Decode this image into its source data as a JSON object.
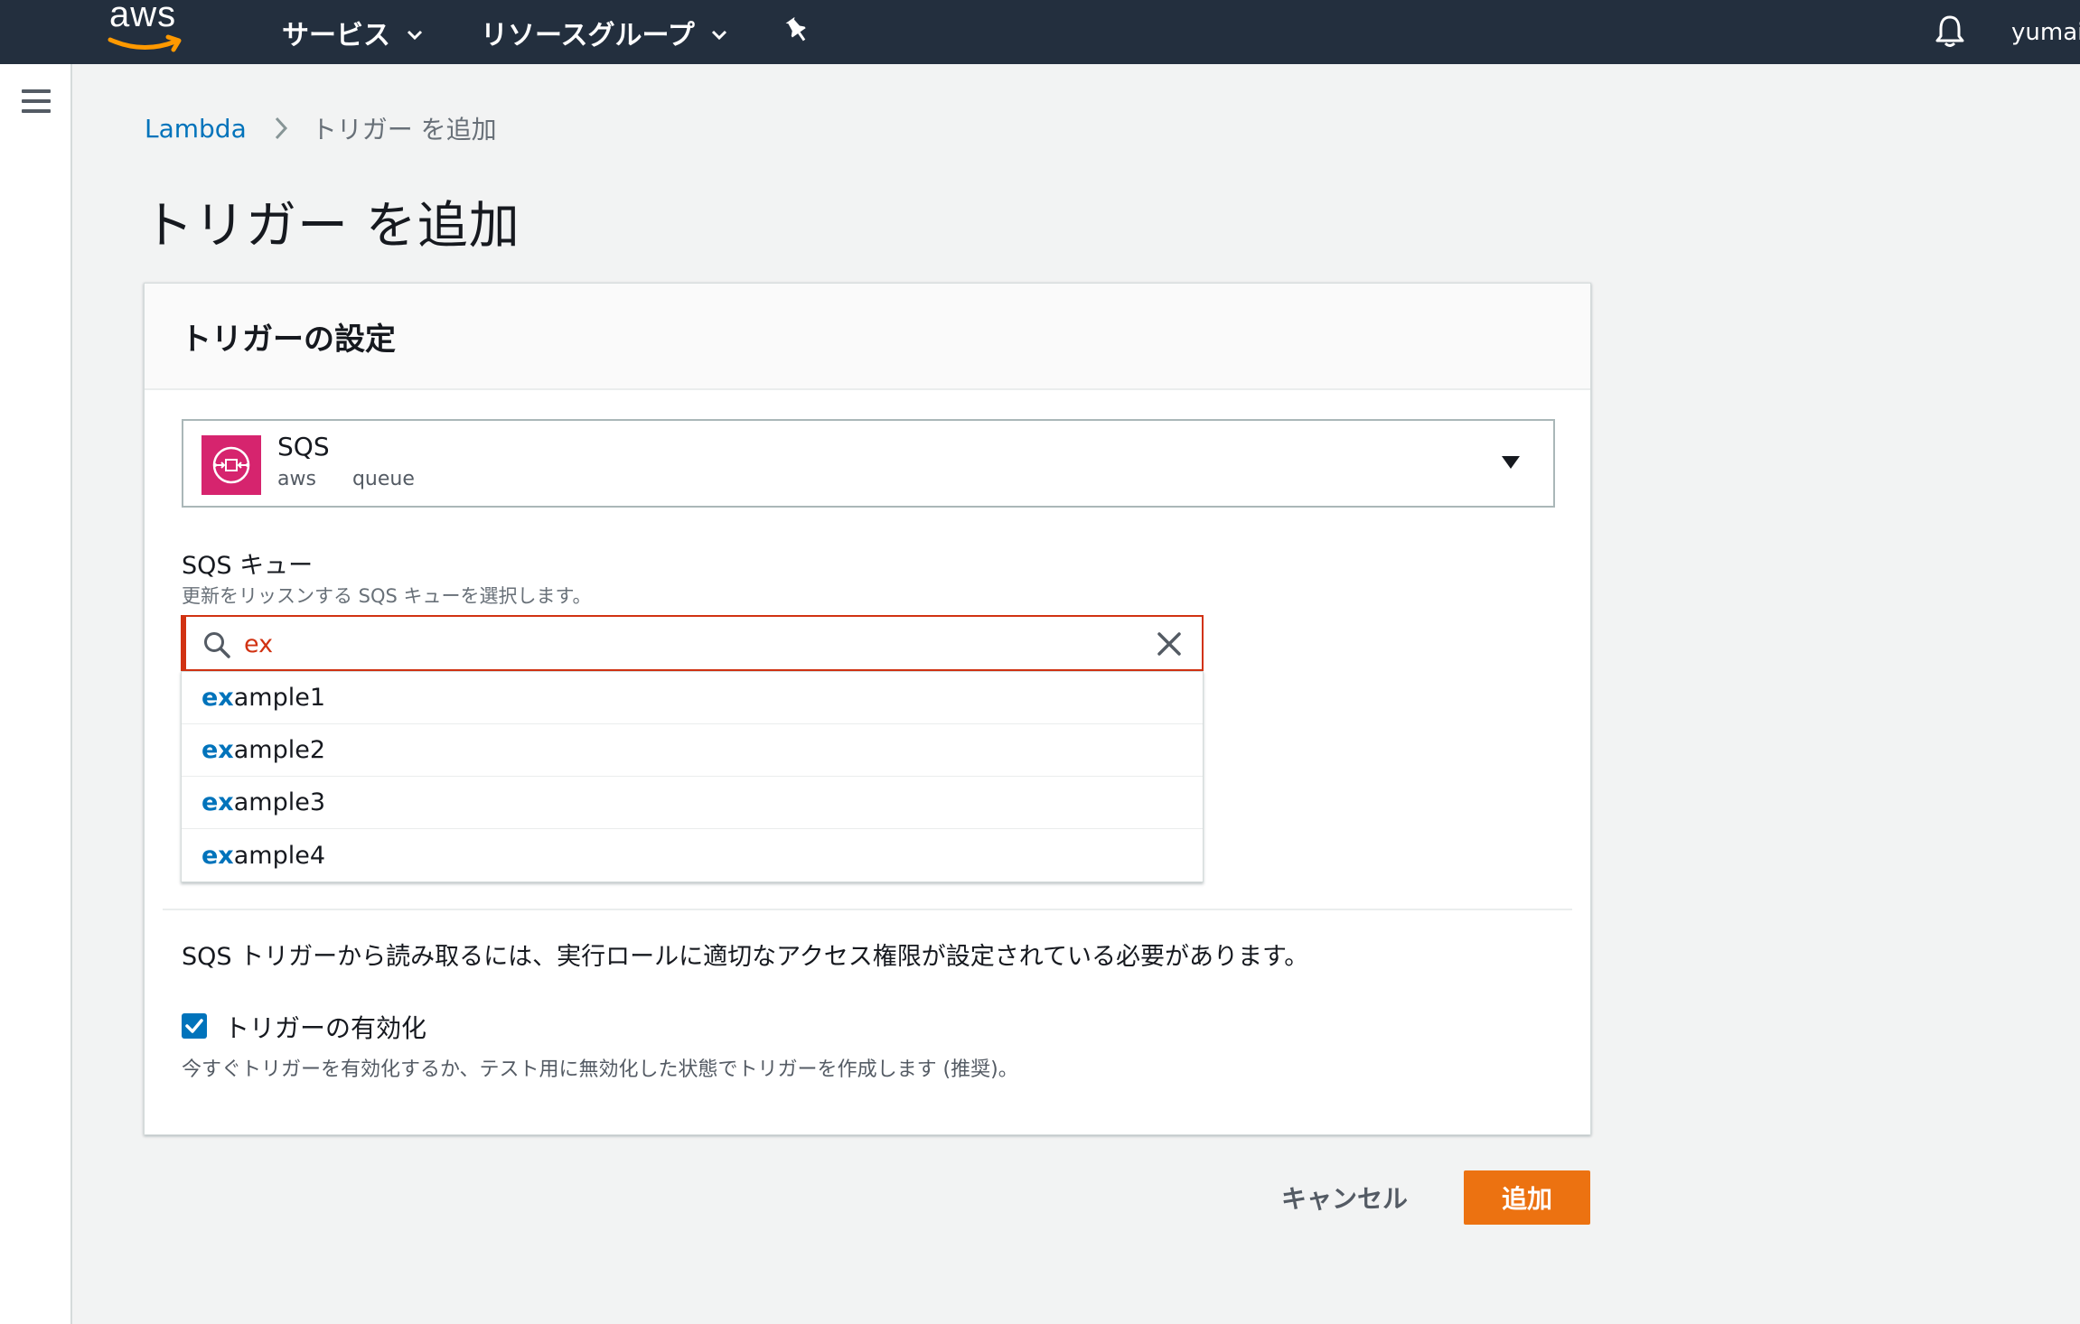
{
  "nav": {
    "logo_text": "aws",
    "services_label": "サービス",
    "resource_groups_label": "リソースグループ",
    "user_label": "yumai"
  },
  "breadcrumb": {
    "parent": "Lambda",
    "current": "トリガー を追加"
  },
  "page": {
    "title": "トリガー を追加"
  },
  "panel": {
    "header": "トリガーの設定",
    "service": {
      "name": "SQS",
      "tags": [
        "aws",
        "queue"
      ]
    },
    "queue_field": {
      "label": "SQS キュー",
      "description": "更新をリッスンする SQS キューを選択します。",
      "search_value": "ex",
      "results": [
        {
          "match": "ex",
          "rest": "ample1"
        },
        {
          "match": "ex",
          "rest": "ample2"
        },
        {
          "match": "ex",
          "rest": "ample3"
        },
        {
          "match": "ex",
          "rest": "ample4"
        }
      ]
    },
    "info_text": "SQS トリガーから読み取るには、実行ロールに適切なアクセス権限が設定されている必要があります。",
    "enable": {
      "label": "トリガーの有効化",
      "description": "今すぐトリガーを有効化するか、テスト用に無効化した状態でトリガーを作成します (推奨)。",
      "checked": true
    }
  },
  "actions": {
    "cancel_label": "キャンセル",
    "add_label": "追加"
  },
  "colors": {
    "nav_bg": "#232f3e",
    "link": "#0073bb",
    "error": "#d13212",
    "primary": "#ec7211",
    "sqs_icon": "#d6246e"
  }
}
